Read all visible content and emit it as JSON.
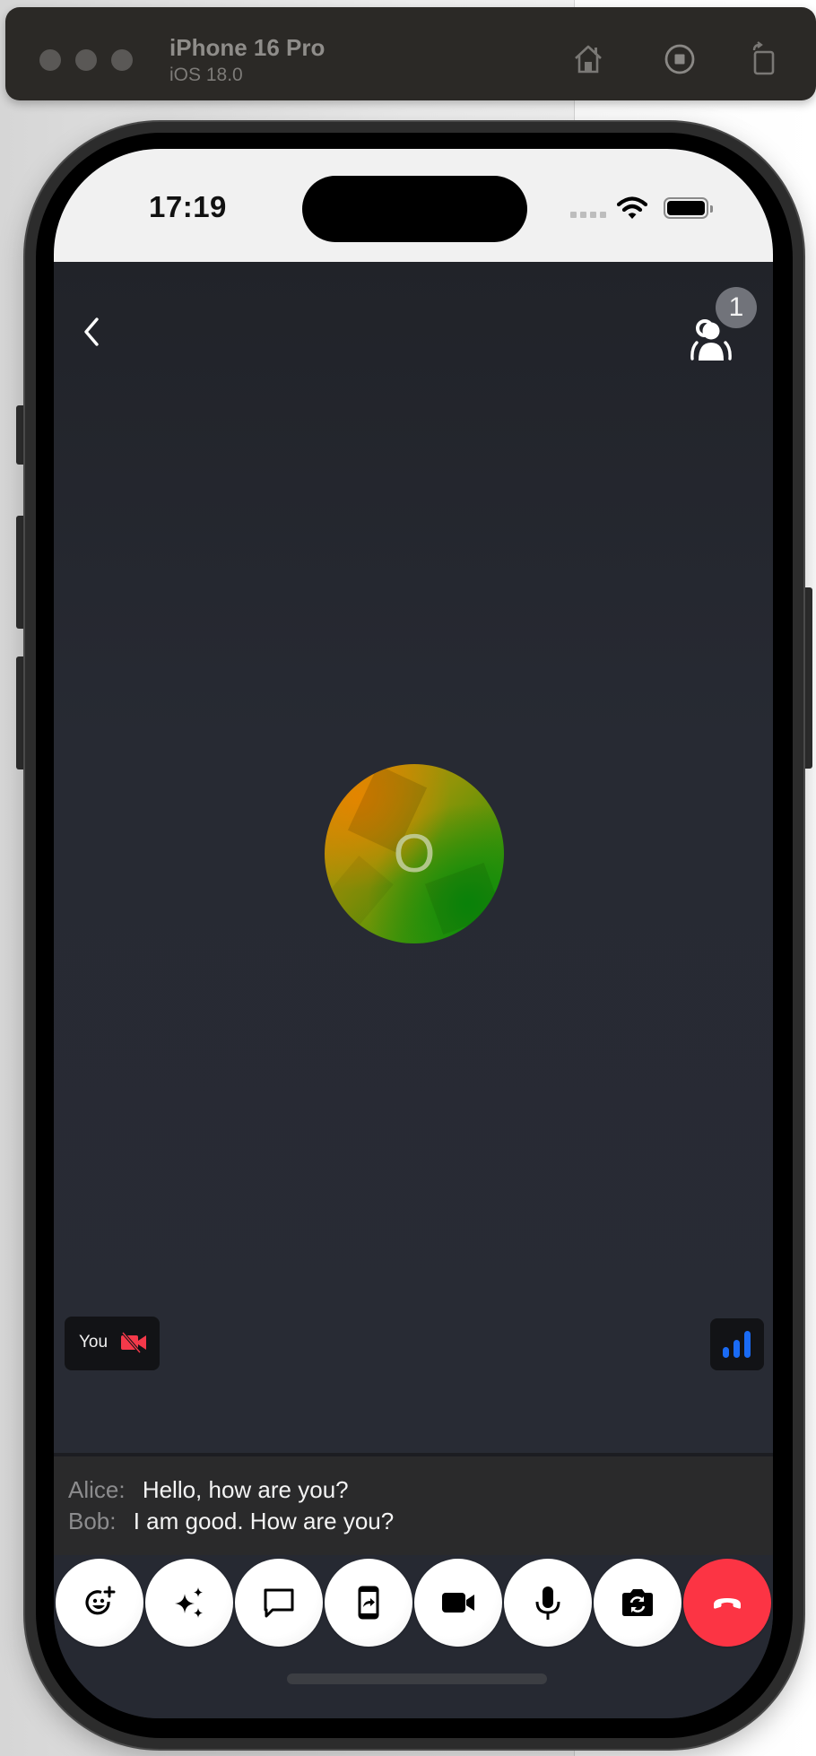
{
  "simulator": {
    "device_name": "iPhone 16 Pro",
    "os_version": "iOS 18.0",
    "toolbar_icons": [
      "home-icon",
      "screenshot-icon",
      "rotate-icon"
    ]
  },
  "status_bar": {
    "time": "17:19",
    "icons": [
      "cellular-signal-icon",
      "wifi-icon",
      "battery-icon"
    ]
  },
  "call": {
    "header": {
      "back_icon": "chevron-left-icon",
      "participants_icon": "participants-icon",
      "participant_count": "1"
    },
    "avatar": {
      "initial": "O",
      "gradient_colors": [
        "#e38500",
        "#1d8f0a"
      ]
    },
    "self_view": {
      "label": "You",
      "camera_state_icon": "video-off-icon",
      "camera_off_color": "#f4394a"
    },
    "network_quality": {
      "icon": "signal-bars-icon",
      "level": "3 of 3 bars",
      "color": "#1a6bf5"
    },
    "captions": [
      {
        "speaker": "Alice:",
        "text": "Hello, how are you?"
      },
      {
        "speaker": "Bob:",
        "text": "I am good. How are you?"
      }
    ],
    "controls": [
      {
        "name": "reactions-button",
        "icon": "emoji-add-icon"
      },
      {
        "name": "effects-button",
        "icon": "sparkles-icon"
      },
      {
        "name": "chat-button",
        "icon": "chat-bubble-icon"
      },
      {
        "name": "screen-share-button",
        "icon": "screen-share-icon"
      },
      {
        "name": "camera-toggle-button",
        "icon": "video-camera-icon"
      },
      {
        "name": "microphone-toggle-button",
        "icon": "microphone-icon"
      },
      {
        "name": "flip-camera-button",
        "icon": "camera-switch-icon"
      },
      {
        "name": "end-call-button",
        "icon": "hang-up-icon",
        "color": "#fc3444"
      }
    ]
  }
}
